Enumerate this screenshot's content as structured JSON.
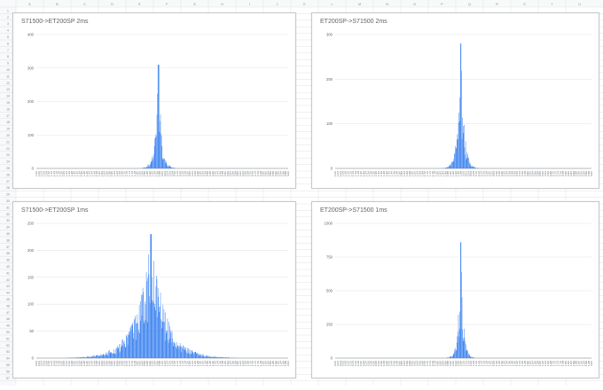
{
  "spreadsheet": {
    "column_headers": [
      "A",
      "B",
      "C",
      "D",
      "E",
      "F",
      "G",
      "H",
      "I",
      "J",
      "K",
      "L",
      "M",
      "N",
      "O",
      "P",
      "Q",
      "R",
      "S",
      "T",
      "U"
    ],
    "row_count": 58,
    "row_start": 1
  },
  "colors": {
    "bar": "#3b82f0",
    "grid": "#e6e6e6",
    "card_border": "#c8c8c8",
    "header_bg": "#f8f9fa",
    "cell_line": "#e2e2e2"
  },
  "chart_data": [
    {
      "type": "bar",
      "title": "S71500->ET200SP 2ms",
      "xlabel": "",
      "ylabel": "",
      "ylim": [
        0,
        400
      ],
      "yticks": [
        "0",
        "100",
        "200",
        "300",
        "400"
      ],
      "xrange": [
        1.0,
        3.0
      ],
      "xtick_step": 0.02,
      "peak_x": 1.97,
      "peak_value": 310,
      "spread": 0.025,
      "legend": "none",
      "grid": true
    },
    {
      "type": "bar",
      "title": "ET200SP->S71500 2ms",
      "xlabel": "",
      "ylabel": "",
      "ylim": [
        0,
        300
      ],
      "yticks": [
        "0",
        "100",
        "200",
        "300"
      ],
      "xrange": [
        1.0,
        3.0
      ],
      "xtick_step": 0.02,
      "peak_x": 1.98,
      "peak_value": 280,
      "spread": 0.025,
      "legend": "none",
      "grid": true
    },
    {
      "type": "bar",
      "title": "S71500->ET200SP 1ms",
      "xlabel": "",
      "ylabel": "",
      "ylim": [
        0,
        250
      ],
      "yticks": [
        "0",
        "50",
        "100",
        "150",
        "200",
        "250"
      ],
      "xrange": [
        0.0,
        2.0
      ],
      "xtick_step": 0.02,
      "peak_x": 0.91,
      "peak_value": 230,
      "spread": 0.12,
      "legend": "none",
      "grid": true
    },
    {
      "type": "bar",
      "title": "ET200SP->S71500 1ms",
      "xlabel": "",
      "ylabel": "",
      "ylim": [
        0,
        1000
      ],
      "yticks": [
        "0",
        "250",
        "500",
        "750",
        "1000"
      ],
      "xrange": [
        0.0,
        2.0
      ],
      "xtick_step": 0.02,
      "peak_x": 0.98,
      "peak_value": 860,
      "spread": 0.02,
      "legend": "none",
      "grid": true
    }
  ]
}
